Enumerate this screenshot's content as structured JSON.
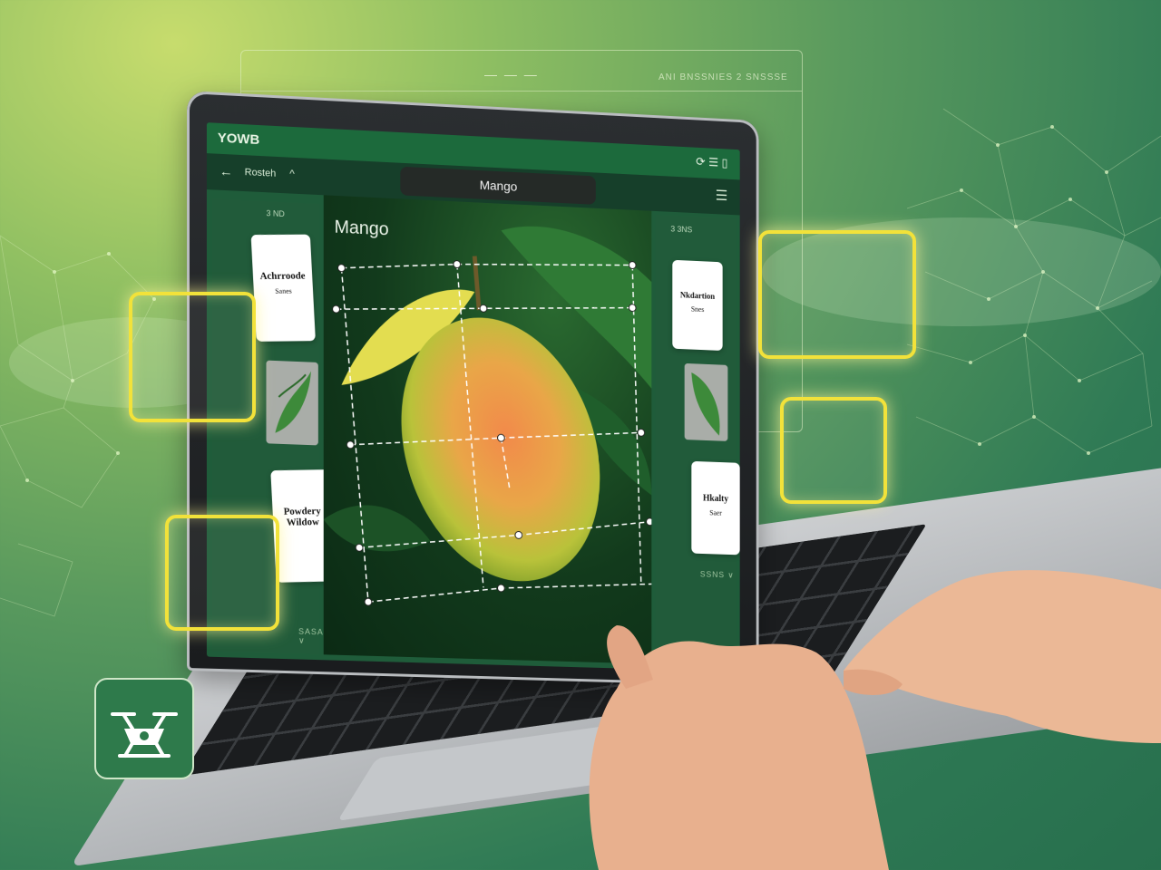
{
  "app": {
    "name": "YOWB",
    "topbar_icons": "⟳ ☰ ▯"
  },
  "subbar": {
    "back_icon": "←",
    "nav_label": "Rosteh",
    "nav_chevron": "^",
    "title": "Mango",
    "menu_icon": "☰"
  },
  "background_frame": {
    "dash": "— — —",
    "label": "ANI BNSSNIES  2  SNSSSE"
  },
  "left_panel": {
    "header": "3 ND",
    "cards": [
      {
        "title": "Achrroode",
        "subtitle": "Sanes"
      },
      {
        "title": "Powdery Wildow",
        "subtitle": ""
      }
    ],
    "footer": "SASAN ∨"
  },
  "right_panel": {
    "header": "3   3NS",
    "cards": [
      {
        "title": "Nkdartion",
        "subtitle": "Snes"
      },
      {
        "title": "Hkalty",
        "subtitle": "Saer"
      }
    ],
    "footer": "SSNS ∨"
  },
  "photo": {
    "label": "Mango"
  },
  "icons": {
    "drone": "drone-icon",
    "back": "arrow-left-icon",
    "menu": "hamburger-menu-icon"
  },
  "colors": {
    "accent_yellow": "#f2e23a",
    "app_green": "#1c6a3c",
    "panel_green": "#215b3a"
  }
}
